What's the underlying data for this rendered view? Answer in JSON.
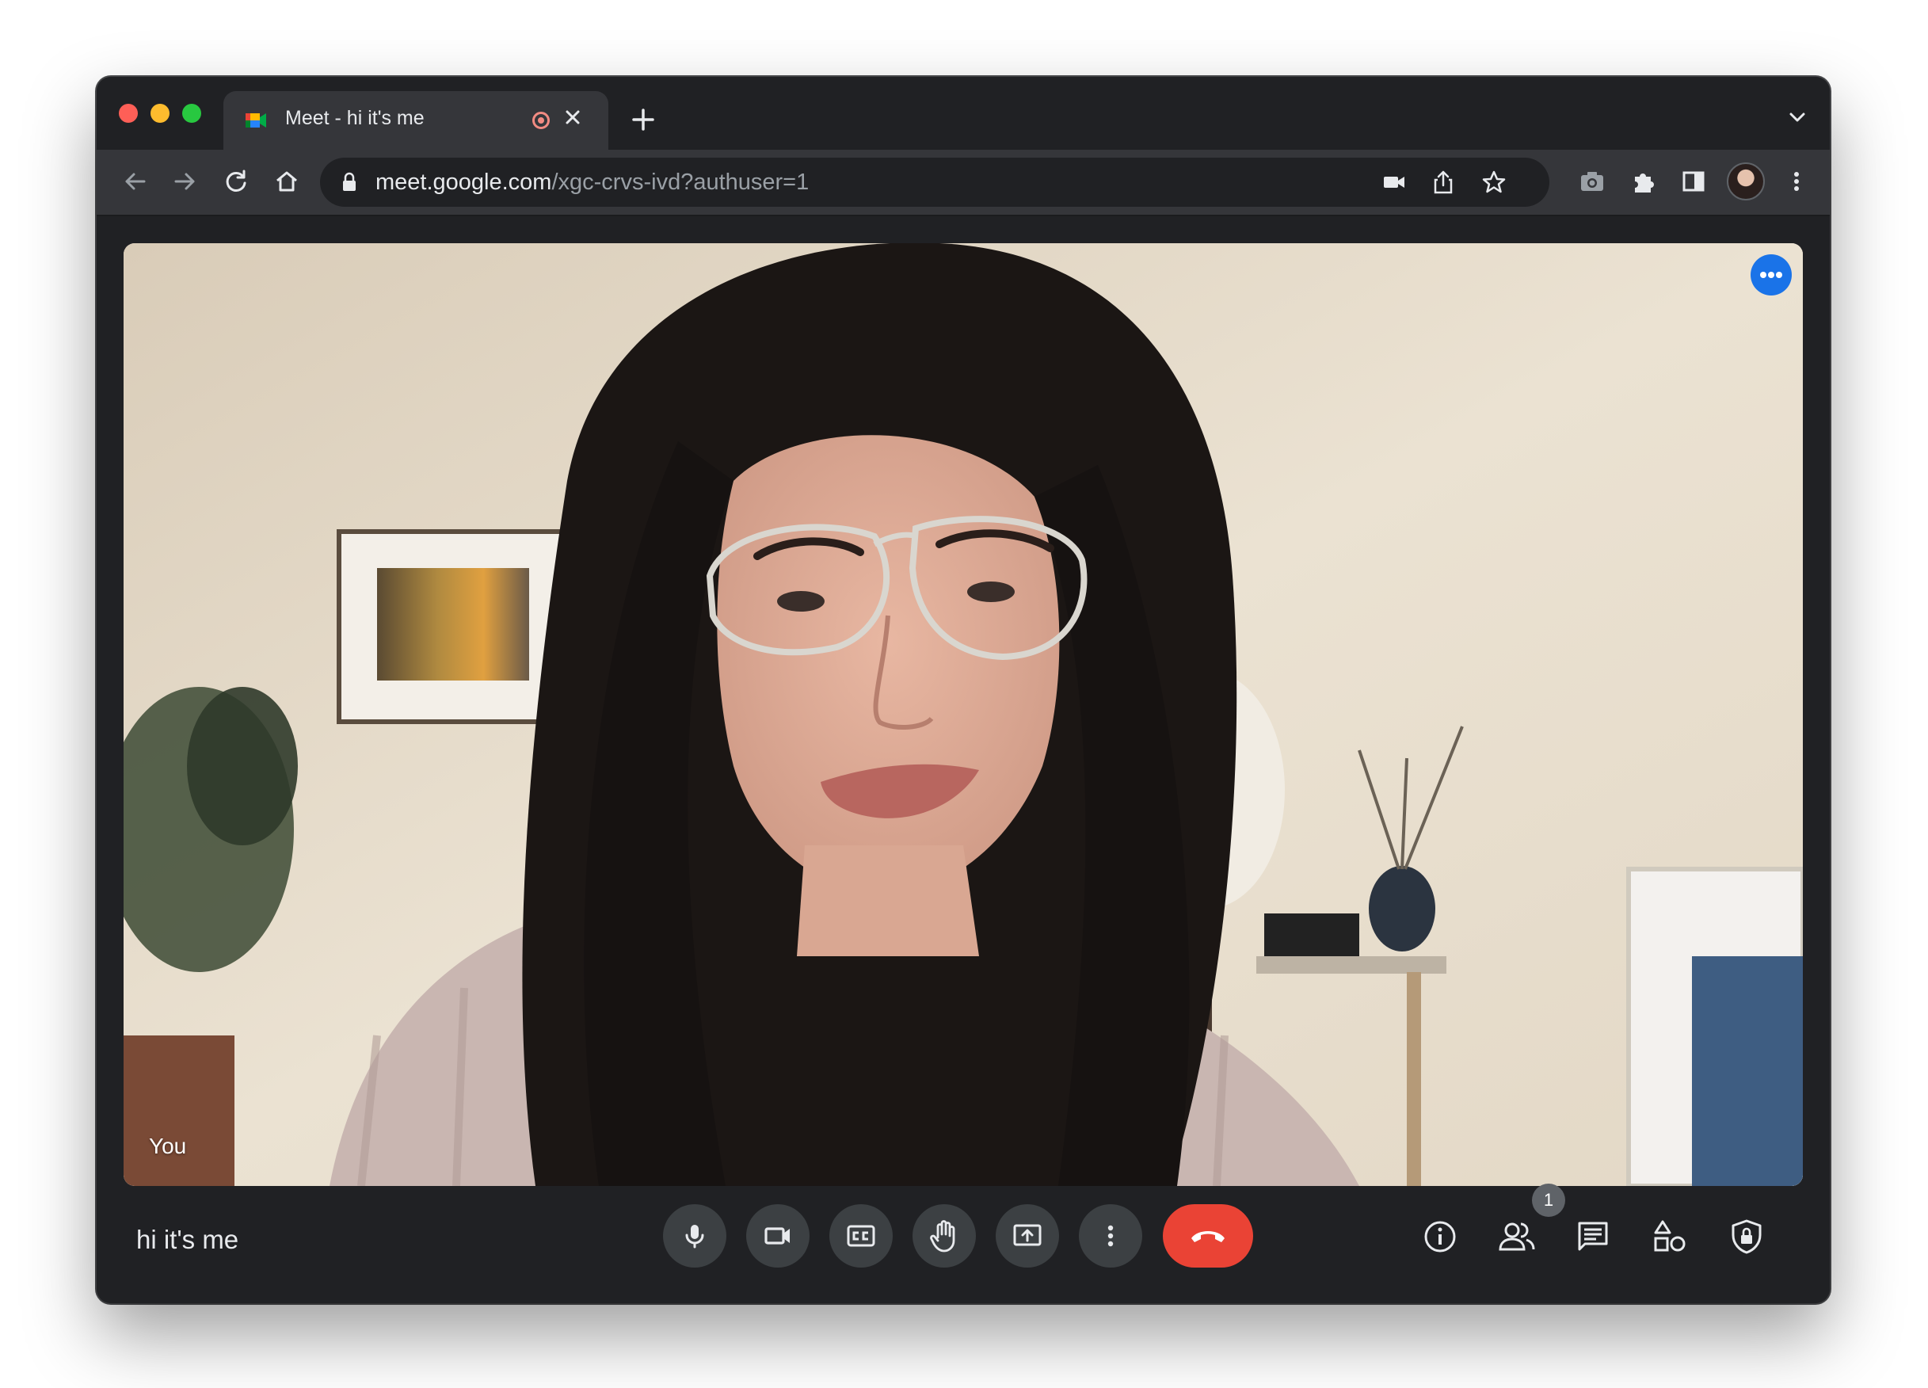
{
  "browser": {
    "tab": {
      "title": "Meet - hi it's me"
    },
    "address": {
      "host": "meet.google.com",
      "path": "/xgc-crvs-ivd?authuser=1"
    }
  },
  "meeting": {
    "self_label": "You",
    "name": "hi it's me",
    "participant_count": "1"
  },
  "controls": {
    "icons": [
      "microphone-icon",
      "camera-icon",
      "captions-icon",
      "raise-hand-icon",
      "present-screen-icon",
      "more-options-icon",
      "end-call-icon"
    ],
    "side_icons": [
      "meeting-details-icon",
      "people-icon",
      "chat-icon",
      "activities-icon",
      "host-controls-icon"
    ]
  },
  "colors": {
    "end_call": "#ea4335",
    "accent": "#1a73e8",
    "background": "#202124"
  }
}
